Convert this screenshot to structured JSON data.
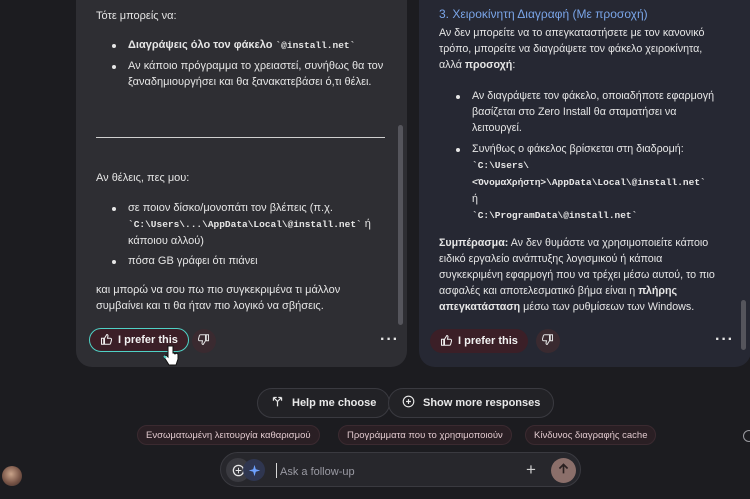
{
  "left": {
    "intro": "Τότε μπορείς να:",
    "bullets": [
      {
        "bold": "Διαγράψεις όλο τον φάκελο",
        "code": "`@install.net`"
      },
      {
        "text": "Αν κάποιο πρόγραμμα το χρειαστεί, συνήθως θα τον ξαναδημιουργήσει και θα ξανακατεβάσει ό,τι θέλει."
      }
    ],
    "ask": "Αν θέλεις, πες μου:",
    "ask_bullets": [
      {
        "pre": "σε ποιον δίσκο/μονοπάτι τον βλέπεις (π.χ.",
        "code": "`C:\\Users\\...\\AppData\\Local\\@install.net`",
        "post": " ή κάποιου αλλού)"
      },
      {
        "text": "πόσα GB γράφει ότι πιάνει"
      }
    ],
    "closing": "και μπορώ να σου πω πιο συγκεκριμένα τι μάλλον συμβαίνει και τι θα ήταν πιο λογικό να σβήσεις.",
    "prefer_label": "I prefer this"
  },
  "right": {
    "heading": "3. Χειροκίνητη Διαγραφή (Με προσοχή)",
    "intro_pre": "Αν δεν μπορείτε να το απεγκαταστήσετε με τον κανονικό τρόπο, μπορείτε να διαγράψετε τον φάκελο χειροκίνητα, αλλά ",
    "intro_bold": "προσοχή",
    "intro_post": ":",
    "bullet1": "Αν διαγράψετε τον φάκελο, οποιαδήποτε εφαρμογή βασίζεται στο Zero Install θα σταματήσει να λειτουργεί.",
    "bullet2": "Συνήθως ο φάκελος βρίσκεται στη διαδρομή:",
    "path1a": "`C:\\Users\\",
    "path1b": "<ΌνομαΧρήστη>\\AppData\\Local\\@install.net`",
    "or": "ή",
    "path2": "`C:\\ProgramData\\@install.net`",
    "summary_label": "Συμπέρασμα:",
    "summary_pre": " Αν δεν θυμάστε να χρησιμοποιείτε κάποιο ειδικό εργαλείο ανάπτυξης λογισμικού ή κάποια συγκεκριμένη εφαρμογή που να τρέχει μέσω αυτού, το πιο ασφαλές και αποτελεσματικό βήμα είναι η ",
    "summary_bold": "πλήρης απεγκατάσταση",
    "summary_post": " μέσω των ρυθμίσεων των Windows.",
    "prefer_label": "I prefer this"
  },
  "actions": {
    "help_label": "Help me choose",
    "more_label": "Show more responses"
  },
  "chips": [
    "Ενσωματωμένη λειτουργία καθαρισμού",
    "Προγράμματα που το χρησιμοποιούν",
    "Κίνδυνος διαγραφής cache"
  ],
  "input": {
    "placeholder": "Ask a follow-up"
  },
  "colors": {
    "accent": "#4fd1c5",
    "prefer_bg": "#3b1f27",
    "send": "#8b6f6a"
  }
}
